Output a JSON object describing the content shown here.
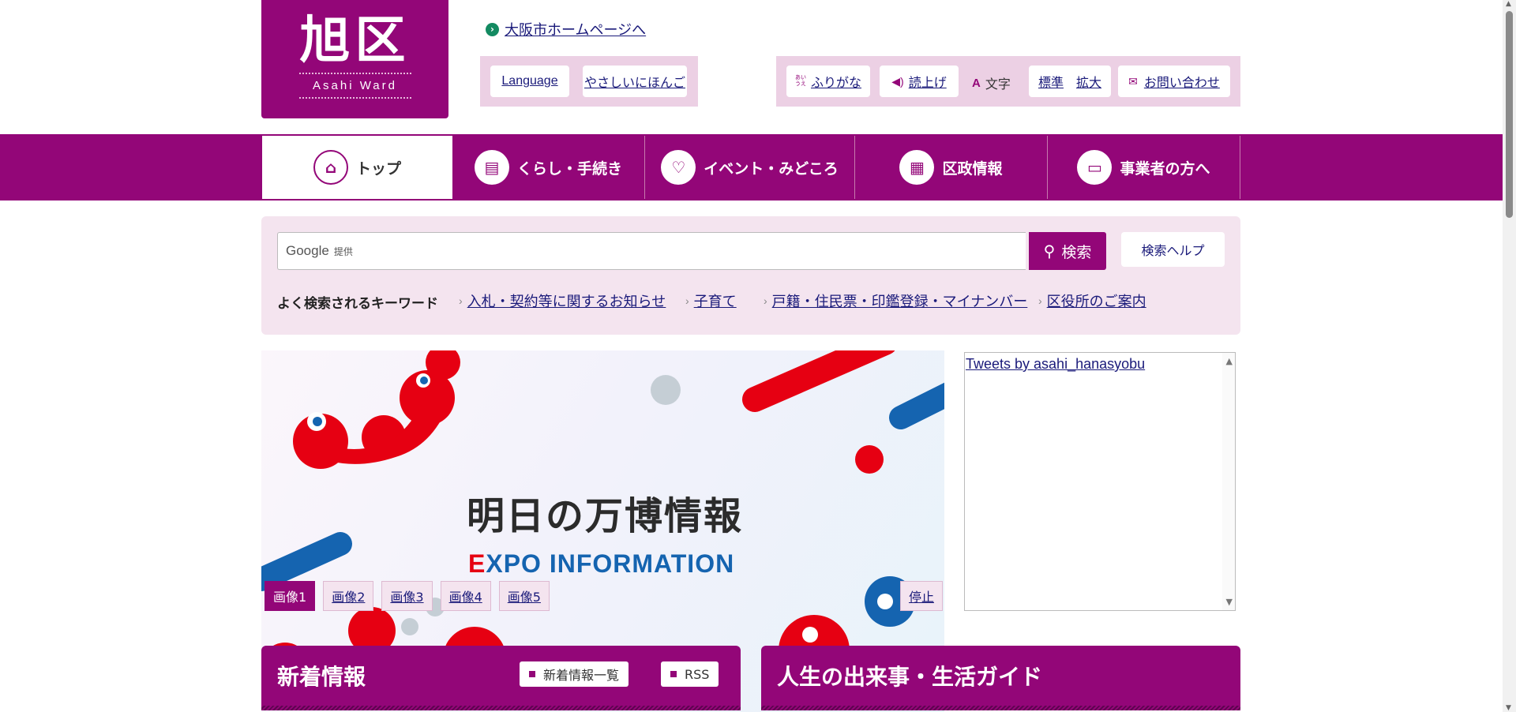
{
  "header": {
    "logo_kanji": "旭区",
    "logo_roman": "Asahi Ward",
    "osaka_link": "大阪市ホームページへ",
    "language_button": "Language",
    "easy_japanese_button": "やさしいにほんご",
    "furigana_icon_text": "あいうえ",
    "furigana_button": "ふりがな",
    "read_aloud_button": "読上げ",
    "text_size_label": "文字",
    "text_standard_button": "標準",
    "text_enlarge_button": "拡大",
    "contact_button": "お問い合わせ"
  },
  "nav": {
    "items": [
      {
        "label": "トップ",
        "icon": "home-icon"
      },
      {
        "label": "くらし・手続き",
        "icon": "document-icon"
      },
      {
        "label": "イベント・みどころ",
        "icon": "balloon-icon"
      },
      {
        "label": "区政情報",
        "icon": "building-icon"
      },
      {
        "label": "事業者の方へ",
        "icon": "briefcase-icon"
      }
    ]
  },
  "search": {
    "brand": "Google",
    "provided": "提供",
    "button": "検索",
    "help_button": "検索ヘルプ",
    "keywords_title": "よく検索されるキーワード",
    "keywords": [
      "入札・契約等に関するお知らせ",
      "子育て",
      "戸籍・住民票・印鑑登録・マイナンバー",
      "区役所のご案内"
    ]
  },
  "slideshow": {
    "headline": "明日の万博情報",
    "sub_first": "E",
    "sub_rest": "XPO INFORMATION",
    "tabs": [
      "画像1",
      "画像2",
      "画像3",
      "画像4",
      "画像5"
    ],
    "stop_button": "停止"
  },
  "tweets": {
    "link": "Tweets by asahi_hanasyobu"
  },
  "sections": {
    "news_title": "新着情報",
    "news_list_button": "新着情報一覧",
    "rss_button": "RSS",
    "life_title": "人生の出来事・生活ガイド"
  },
  "colors": {
    "brand": "#930678",
    "panel": "#f4e4ef",
    "tool_panel": "#ecd0e4",
    "link": "#1a1a7a",
    "expo_blue": "#1564b0",
    "expo_red": "#e60012"
  }
}
